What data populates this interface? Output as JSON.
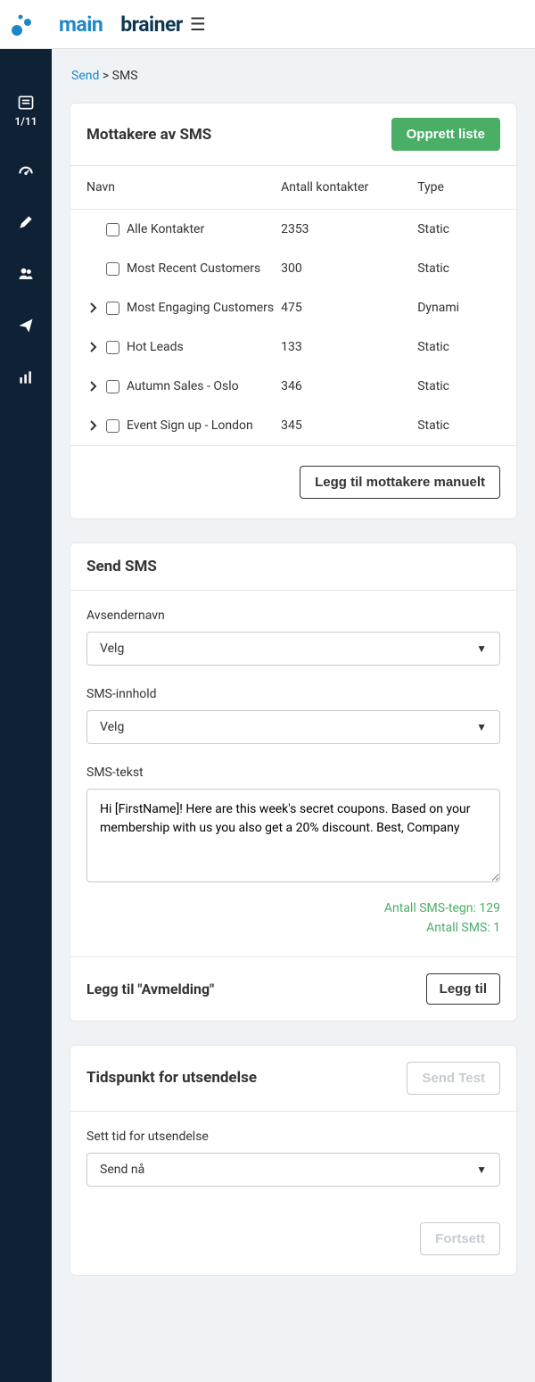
{
  "logo": {
    "main": "main",
    "brainer": "brainer"
  },
  "step": "1/11",
  "breadcrumb": {
    "root": "Send",
    "current": "SMS"
  },
  "recipients": {
    "title": "Mottakere av SMS",
    "create_list": "Opprett liste",
    "cols": {
      "name": "Navn",
      "contacts": "Antall kontakter",
      "type": "Type"
    },
    "rows": [
      {
        "expandable": false,
        "name": "Alle Kontakter",
        "contacts": "2353",
        "type": "Static"
      },
      {
        "expandable": false,
        "name": "Most Recent Customers",
        "contacts": "300",
        "type": "Static"
      },
      {
        "expandable": true,
        "name": "Most Engaging Customers",
        "contacts": "475",
        "type": "Dynami"
      },
      {
        "expandable": true,
        "name": "Hot Leads",
        "contacts": "133",
        "type": "Static"
      },
      {
        "expandable": true,
        "name": "Autumn Sales - Oslo",
        "contacts": "346",
        "type": "Static"
      },
      {
        "expandable": true,
        "name": "Event Sign up - London",
        "contacts": "345",
        "type": "Static"
      }
    ],
    "add_manual": "Legg til mottakere manuelt"
  },
  "send_sms": {
    "title": "Send SMS",
    "sender_label": "Avsendernavn",
    "sender_value": "Velg",
    "content_label": "SMS-innhold",
    "content_value": "Velg",
    "text_label": "SMS-tekst",
    "text_value": "Hi [FirstName]! Here are this week's secret coupons. Based on your membership with us you also get a 20% discount. Best, Company",
    "char_count": "Antall SMS-tegn: 129",
    "sms_count": "Antall SMS: 1",
    "unsubscribe_label": "Legg til \"Avmelding\"",
    "unsubscribe_btn": "Legg til"
  },
  "timing": {
    "title": "Tidspunkt for utsendelse",
    "send_test": "Send Test",
    "set_time_label": "Sett tid for utsendelse",
    "set_time_value": "Send nå",
    "proceed": "Fortsett"
  }
}
